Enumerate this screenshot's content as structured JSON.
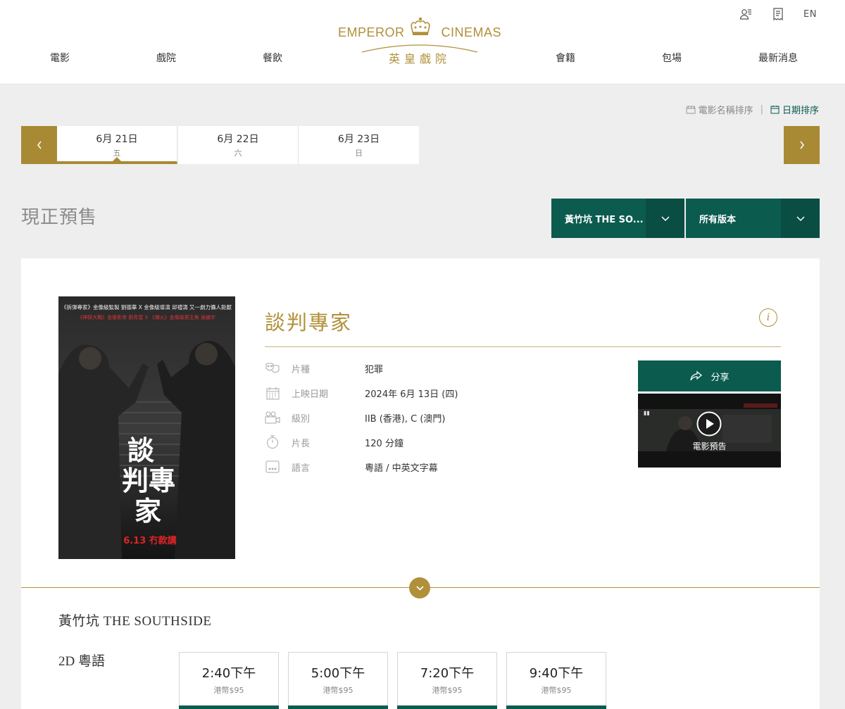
{
  "header": {
    "brand_left": "EMPEROR",
    "brand_right": "CINEMAS",
    "brand_cn": "英皇戲院",
    "lang": "EN",
    "util_icons": [
      "member-icon",
      "receipt-icon"
    ],
    "nav": [
      "電影",
      "戲院",
      "餐飲",
      "會籍",
      "包場",
      "最新消息"
    ]
  },
  "sort": {
    "by_name": "電影名稱排序",
    "separator": "|",
    "by_date": "日期排序"
  },
  "dates": [
    {
      "date": "6月 21日",
      "weekday": "五",
      "active": true
    },
    {
      "date": "6月 22日",
      "weekday": "六",
      "active": false
    },
    {
      "date": "6月 23日",
      "weekday": "日",
      "active": false
    }
  ],
  "presale_title": "現正預售",
  "filters": {
    "cinema": "黃竹坑 THE SO...",
    "version": "所有版本"
  },
  "movie": {
    "title": "談判專家",
    "details": [
      {
        "icon": "masks-icon",
        "label": "片種",
        "value": "犯罪"
      },
      {
        "icon": "calendar-icon",
        "label": "上映日期",
        "value": "2024年 6月 13日 (四)"
      },
      {
        "icon": "rating-icon",
        "label": "級別",
        "value": "IIB (香港), C (澳門)"
      },
      {
        "icon": "stopwatch-icon",
        "label": "片長",
        "value": "120 分鐘"
      },
      {
        "icon": "language-icon",
        "label": "語言",
        "value": "粵語 / 中英文字幕"
      }
    ],
    "share_label": "分享",
    "trailer_label": "電影預告",
    "poster": {
      "line1": "《拆彈專家》金像級監製 劉德華 X 金像級導演 邱禮濤 又一劇力懾人鉅獻",
      "line2": "《神探大戰》金像影帝 劉青雲 X 《爛火》金像級男主角 吳鎮宇",
      "title_chars": [
        "談",
        "判",
        "專",
        "家"
      ],
      "release": "6.13 冇款講"
    }
  },
  "cinema_name": "黃竹坑 THE SOUTHSIDE",
  "version_name": "2D 粵語",
  "showtimes": [
    {
      "time": "2:40下午",
      "price": "港幣$95"
    },
    {
      "time": "5:00下午",
      "price": "港幣$95"
    },
    {
      "time": "7:20下午",
      "price": "港幣$95"
    },
    {
      "time": "9:40下午",
      "price": "港幣$95"
    }
  ],
  "colors": {
    "gold": "#a88a35",
    "green": "#0b5b4f",
    "bg": "#eeeeee"
  }
}
